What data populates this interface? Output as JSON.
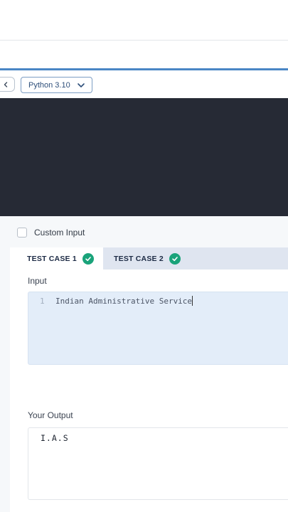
{
  "toolbar": {
    "language": "Python 3.10"
  },
  "panel": {
    "custom_input_label": "Custom Input",
    "tabs": [
      {
        "label": "TEST CASE 1",
        "status": "passed"
      },
      {
        "label": "TEST CASE 2",
        "status": "passed"
      }
    ],
    "input_label": "Input",
    "input_line_number": "1",
    "input_text": "Indian Administrative Service",
    "output_label": "Your Output",
    "output_text": "I.A.S"
  },
  "colors": {
    "accent": "#4a86c5",
    "editor_bg": "#262a35",
    "success": "#1aa37a"
  },
  "icons": [
    "chevron-left-icon",
    "chevron-down-icon",
    "check-circle-icon"
  ]
}
